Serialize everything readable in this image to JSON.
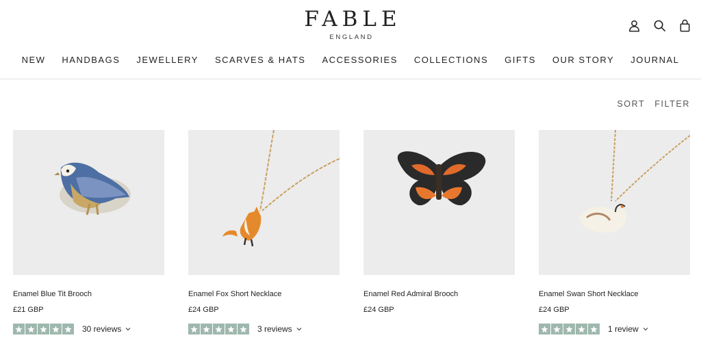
{
  "brand": {
    "name": "FABLE",
    "tagline": "ENGLAND"
  },
  "header_icons": [
    "account-icon",
    "search-icon",
    "bag-icon"
  ],
  "nav": [
    "NEW",
    "HANDBAGS",
    "JEWELLERY",
    "SCARVES & HATS",
    "ACCESSORIES",
    "COLLECTIONS",
    "GIFTS",
    "OUR STORY",
    "JOURNAL"
  ],
  "toolbar": {
    "sort": "SORT",
    "filter": "FILTER"
  },
  "colors": {
    "star_bg": "#9fb8ae",
    "image_bg": "#ececec",
    "divider": "#e3e3e3"
  },
  "products": [
    {
      "title": "Enamel Blue Tit Brooch",
      "price": "£21 GBP",
      "rating": 5,
      "reviews": "30 reviews"
    },
    {
      "title": "Enamel Fox Short Necklace",
      "price": "£24 GBP",
      "rating": 5,
      "reviews": "3 reviews"
    },
    {
      "title": "Enamel Red Admiral Brooch",
      "price": "£24 GBP",
      "rating": 5,
      "reviews": ""
    },
    {
      "title": "Enamel Swan Short Necklace",
      "price": "£24 GBP",
      "rating": 5,
      "reviews": "1 review"
    }
  ]
}
